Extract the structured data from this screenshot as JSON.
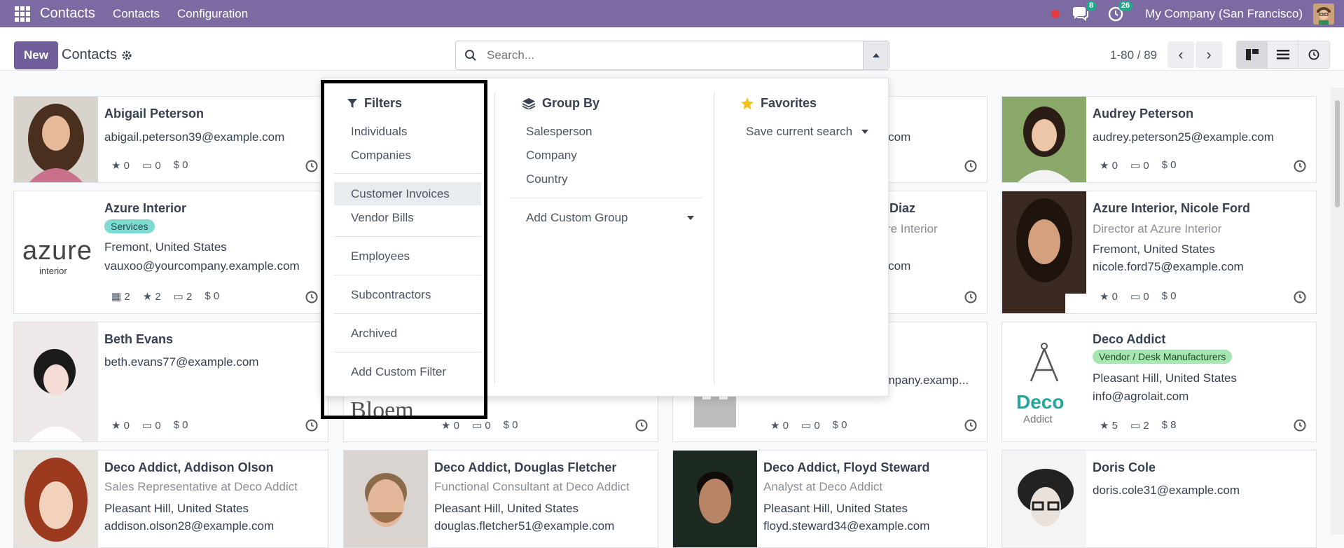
{
  "topbar": {
    "brand": "Contacts",
    "menu": [
      "Contacts",
      "Configuration"
    ],
    "messages_count": "8",
    "activities_count": "26",
    "company": "My Company (San Francisco)"
  },
  "control": {
    "new_label": "New",
    "breadcrumb": "Contacts",
    "search_placeholder": "Search...",
    "pager": "1-80 / 89"
  },
  "dropdown": {
    "filters": {
      "title": "Filters",
      "items": [
        "Individuals",
        "Companies",
        "Customer Invoices",
        "Vendor Bills",
        "Employees",
        "Subcontractors",
        "Archived",
        "Add Custom Filter"
      ]
    },
    "group_by": {
      "title": "Group By",
      "items": [
        "Salesperson",
        "Company",
        "Country"
      ],
      "custom": "Add Custom Group"
    },
    "favorites": {
      "title": "Favorites",
      "save": "Save current search"
    }
  },
  "partial_texts": {
    "row1_col3_email": "e.com",
    "row2_col3_name": "en Diaz",
    "row2_col3_company": "zure Interior",
    "row2_col3_email": "e.com",
    "row3_col3_email": "ompany.examp...",
    "row3_col2_logo": "Bloem"
  },
  "cards": [
    {
      "name": "Abigail Peterson",
      "email": "abigail.peterson39@example.com",
      "stars": "0",
      "cards": "0",
      "money": "$ 0"
    },
    {
      "name": "Audrey Peterson",
      "email": "audrey.peterson25@example.com",
      "stars": "0",
      "cards": "0",
      "money": "$ 0"
    },
    {
      "name": "Azure Interior",
      "tag": "Services",
      "location": "Fremont, United States",
      "email": "vauxoo@yourcompany.example.com",
      "meetings": "2",
      "stars": "2",
      "cards": "2",
      "money": "$ 0",
      "logo_main": "azure",
      "logo_sub": "interior"
    },
    {
      "name": "Azure Interior, Nicole Ford",
      "title": "Director at Azure Interior",
      "location": "Fremont, United States",
      "email": "nicole.ford75@example.com",
      "stars": "0",
      "cards": "0",
      "money": "$ 0"
    },
    {
      "name": "Beth Evans",
      "email": "beth.evans77@example.com",
      "stars": "0",
      "cards": "0",
      "money": "$ 0"
    },
    {
      "name": "Deco Addict",
      "tag": "Vendor / Desk Manufacturers",
      "location": "Pleasant Hill, United States",
      "email": "info@agrolait.com",
      "stars": "5",
      "cards": "2",
      "money": "$ 8",
      "logo_main": "Deco",
      "logo_sub": "Addict"
    },
    {
      "name": "Deco Addict, Addison Olson",
      "title": "Sales Representative at Deco Addict",
      "location": "Pleasant Hill, United States",
      "email": "addison.olson28@example.com"
    },
    {
      "name": "Deco Addict, Douglas Fletcher",
      "title": "Functional Consultant at Deco Addict",
      "location": "Pleasant Hill, United States",
      "email": "douglas.fletcher51@example.com"
    },
    {
      "name": "Deco Addict, Floyd Steward",
      "title": "Analyst at Deco Addict",
      "location": "Pleasant Hill, United States",
      "email": "floyd.steward34@example.com"
    },
    {
      "name": "Doris Cole",
      "email": "doris.cole31@example.com"
    }
  ],
  "hidden_row_stats": [
    {
      "stars": "0",
      "cards": "0",
      "money": "$ 0"
    },
    {
      "stars": "0",
      "cards": "0",
      "money": "$ 0"
    }
  ],
  "colors": {
    "topbar": "#7c6ba3",
    "primary": "#6f5e9a",
    "tag_services": "#7fdad1",
    "tag_vendor": "#a6e6b3"
  }
}
